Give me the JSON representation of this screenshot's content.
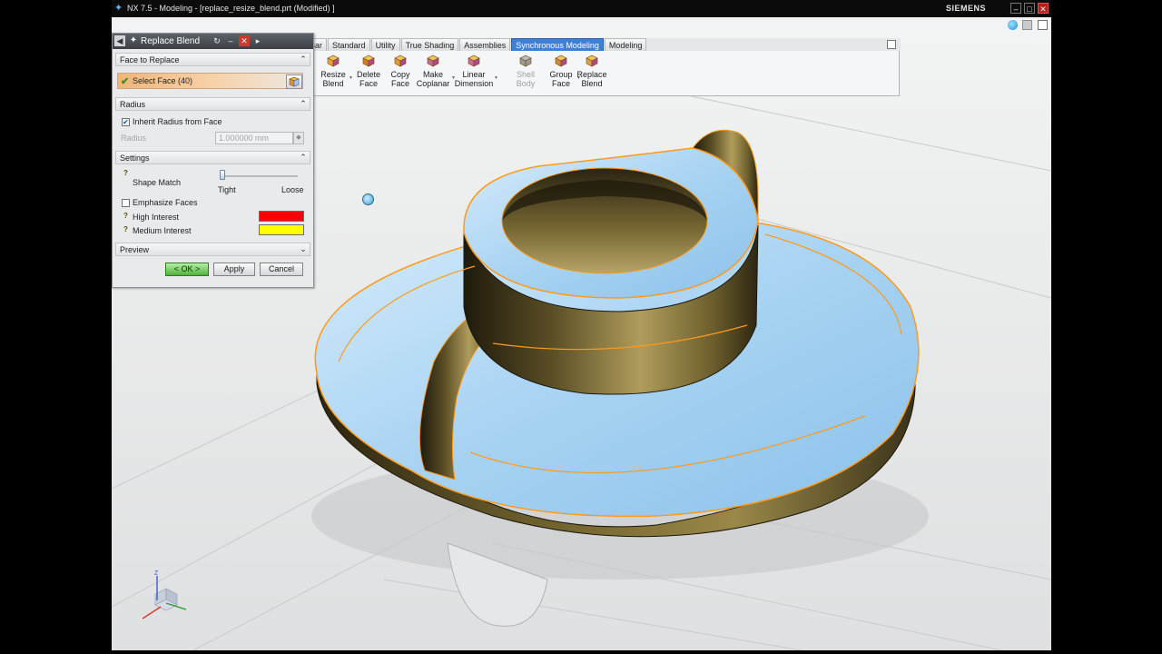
{
  "window": {
    "title": "NX 7.5 - Modeling - [replace_resize_blend.prt (Modified) ]",
    "brand": "SIEMENS",
    "controls": {
      "minimize": "–",
      "maximize": "□",
      "close": "✕"
    }
  },
  "toolbar": {
    "tabs": [
      {
        "label": "Resource Bar",
        "active": false
      },
      {
        "label": "Standard",
        "active": false
      },
      {
        "label": "Utility",
        "active": false
      },
      {
        "label": "True Shading",
        "active": false
      },
      {
        "label": "Assemblies",
        "active": false
      },
      {
        "label": "Synchronous Modeling",
        "active": true
      },
      {
        "label": "Modeling",
        "active": false
      }
    ],
    "buttons": [
      {
        "line1": "Resize",
        "line2": "Blend",
        "icon": "resize-blend-icon",
        "enabled": true
      },
      {
        "line1": "Delete",
        "line2": "Face",
        "icon": "delete-face-icon",
        "enabled": true
      },
      {
        "line1": "Copy",
        "line2": "Face",
        "icon": "copy-face-icon",
        "enabled": true
      },
      {
        "line1": "Make",
        "line2": "Coplanar",
        "icon": "make-coplanar-icon",
        "enabled": true
      },
      {
        "line1": "Linear",
        "line2": "Dimension",
        "icon": "linear-dimension-icon",
        "enabled": true
      },
      {
        "line1": "Shell",
        "line2": "Body",
        "icon": "shell-body-icon",
        "enabled": false
      },
      {
        "line1": "Group",
        "line2": "Face",
        "icon": "group-face-icon",
        "enabled": true
      },
      {
        "line1": "Replace",
        "line2": "Blend",
        "icon": "replace-blend-icon",
        "enabled": true
      }
    ]
  },
  "dialog": {
    "title": "Replace Blend",
    "title_controls": {
      "reset": "↻",
      "minimize": "–",
      "close": "✕",
      "more": "▸"
    },
    "face_to_replace": {
      "header": "Face to Replace",
      "select_label": "Select Face (40)"
    },
    "radius": {
      "header": "Radius",
      "inherit_label": "Inherit Radius from Face",
      "inherit_checked": true,
      "field_label": "Radius",
      "field_value": "1.000000",
      "field_unit": "mm"
    },
    "settings": {
      "header": "Settings",
      "shape_match_label": "Shape Match",
      "tight_label": "Tight",
      "loose_label": "Loose",
      "shape_match_value": 0,
      "emphasize_label": "Emphasize Faces",
      "emphasize_checked": false,
      "high_interest_label": "High Interest",
      "high_interest_color": "#ff0000",
      "medium_interest_label": "Medium Interest",
      "medium_interest_color": "#ffff00"
    },
    "preview": {
      "header": "Preview"
    },
    "buttons": {
      "ok": "< OK >",
      "apply": "Apply",
      "cancel": "Cancel"
    }
  },
  "viewport": {
    "part_face_color": "#a8d3f3",
    "part_side_color": "#6b5d2c",
    "edge_highlight_color": "#ff9a1a"
  }
}
